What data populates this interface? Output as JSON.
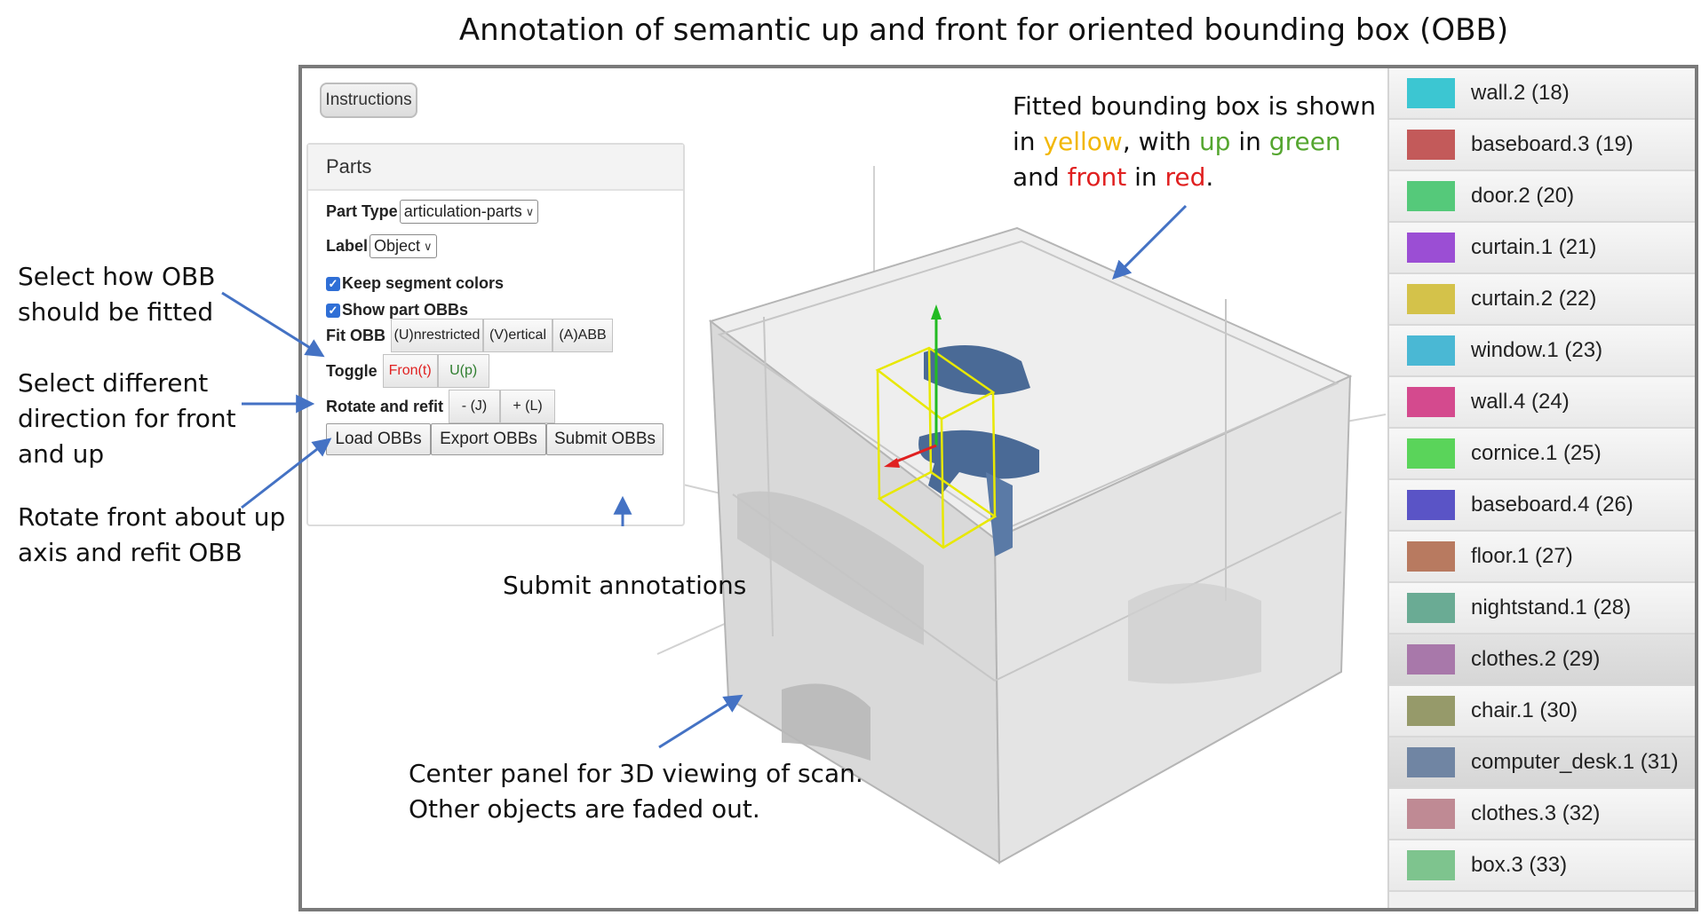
{
  "figure_title": "Annotation of semantic up and front for oriented bounding box (OBB)",
  "toolbar": {
    "instructions_label": "Instructions"
  },
  "parts_panel": {
    "header": "Parts",
    "part_type_label": "Part Type",
    "part_type_value": "articulation-parts",
    "label_label": "Label",
    "label_value": "Object",
    "keep_colors_label": "Keep segment colors",
    "show_obbs_label": "Show part OBBs",
    "fit_obb_label": "Fit OBB",
    "fit_buttons": [
      "(U)nrestricted",
      "(V)ertical",
      "(A)ABB"
    ],
    "toggle_label": "Toggle",
    "toggle_front": "Fron(t)",
    "toggle_up": "U(p)",
    "rotate_label": "Rotate and refit",
    "rotate_minus": "- (J)",
    "rotate_plus": "+ (L)",
    "load_obbs": "Load OBBs",
    "export_obbs": "Export OBBs",
    "submit_obbs": "Submit OBBs"
  },
  "colors": {
    "front": "#e02020",
    "up": "#3a9a3a",
    "obb": "#e8e800",
    "highlight_object": "#4a6a96"
  },
  "segments": [
    {
      "label": "wall.2 (18)",
      "color": "#3cc6d2"
    },
    {
      "label": "baseboard.3 (19)",
      "color": "#c35a5a"
    },
    {
      "label": "door.2 (20)",
      "color": "#55c97a"
    },
    {
      "label": "curtain.1 (21)",
      "color": "#9b4ed4"
    },
    {
      "label": "curtain.2 (22)",
      "color": "#d4c24a"
    },
    {
      "label": "window.1 (23)",
      "color": "#4ab8d4"
    },
    {
      "label": "wall.4 (24)",
      "color": "#d44a8e"
    },
    {
      "label": "cornice.1 (25)",
      "color": "#5ad45a"
    },
    {
      "label": "baseboard.4 (26)",
      "color": "#5a54c6"
    },
    {
      "label": "floor.1 (27)",
      "color": "#b87a60"
    },
    {
      "label": "nightstand.1 (28)",
      "color": "#6aab94"
    },
    {
      "label": "clothes.2 (29)",
      "color": "#a878aa"
    },
    {
      "label": "chair.1 (30)",
      "color": "#969a6a"
    },
    {
      "label": "computer_desk.1 (31)",
      "color": "#7085a3"
    },
    {
      "label": "clothes.3 (32)",
      "color": "#bf8a94"
    },
    {
      "label": "box.3 (33)",
      "color": "#7ec48e"
    }
  ],
  "annotations": {
    "fit_obb": [
      "Select how OBB",
      "should be fitted"
    ],
    "toggle": [
      "Select different",
      "direction for front",
      "and up"
    ],
    "rotate": [
      "Rotate front about up",
      "axis and refit OBB"
    ],
    "submit": "Submit annotations",
    "center_panel": [
      "Center panel for 3D viewing of scan.",
      "Other objects are faded out."
    ],
    "bbox_line1": "Fitted bounding box is shown",
    "bbox_in": "in ",
    "bbox_yellow": "yellow",
    "bbox_with_up_in": ", with ",
    "bbox_up": "up",
    "bbox_in2": " in ",
    "bbox_green": "green",
    "bbox_and": "and ",
    "bbox_front": "front",
    "bbox_in3": " in ",
    "bbox_red": "red",
    "bbox_period": "."
  }
}
